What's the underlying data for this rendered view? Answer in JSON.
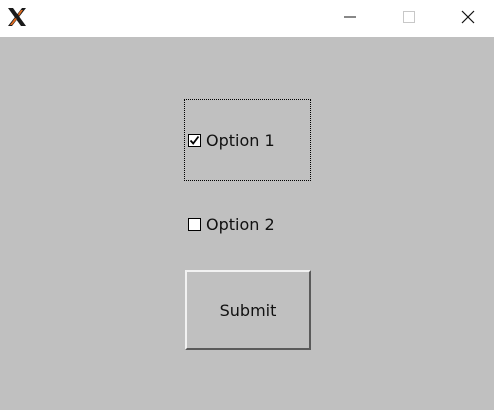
{
  "window": {
    "icon": "x11-logo-icon",
    "controls": {
      "minimize": "minimize-icon",
      "maximize": "maximize-icon",
      "close": "close-icon"
    }
  },
  "form": {
    "option1": {
      "label": "Option 1",
      "checked": true,
      "focused": true
    },
    "option2": {
      "label": "Option 2",
      "checked": false
    },
    "submit_label": "Submit"
  },
  "colors": {
    "background": "#c0c0c0",
    "titlebar": "#ffffff"
  }
}
